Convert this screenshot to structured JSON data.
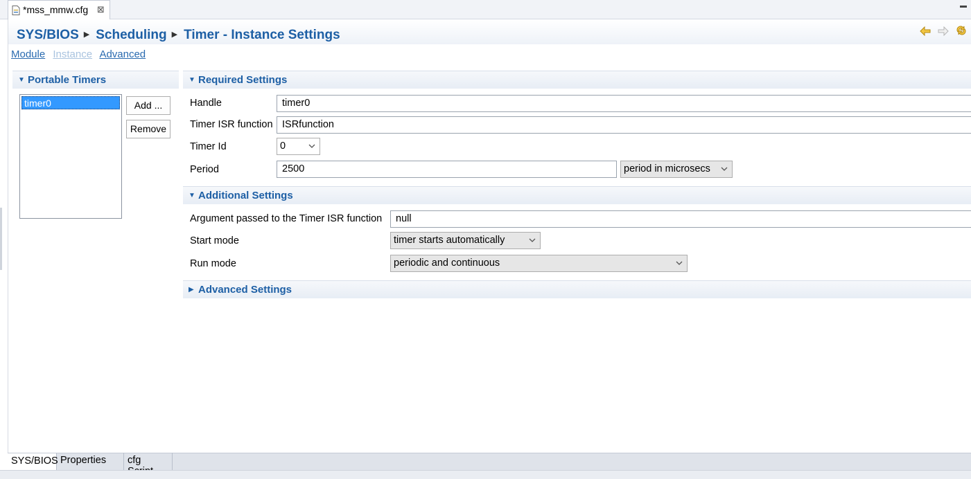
{
  "editor_tab": {
    "title": "*mss_mmw.cfg",
    "close_glyph": "⊠"
  },
  "breadcrumb": [
    "SYS/BIOS",
    "Scheduling",
    "Timer - Instance Settings"
  ],
  "nav_icons": [
    "back-arrow-icon",
    "forward-arrow-icon",
    "sync-icon"
  ],
  "view_links": {
    "module": "Module",
    "instance": "Instance",
    "advanced": "Advanced"
  },
  "portable_timers": {
    "title": "Portable Timers",
    "items": [
      "timer0"
    ],
    "selected": "timer0",
    "add_label": "Add ...",
    "remove_label": "Remove"
  },
  "required_settings": {
    "title": "Required Settings",
    "handle_label": "Handle",
    "handle_value": "timer0",
    "isr_label": "Timer ISR function",
    "isr_value": "ISRfunction",
    "timer_id_label": "Timer Id",
    "timer_id_value": "0",
    "period_label": "Period",
    "period_value": "2500",
    "period_unit": "period in microsecs"
  },
  "additional_settings": {
    "title": "Additional Settings",
    "arg_label": "Argument passed to the Timer ISR function",
    "arg_value": "null",
    "start_mode_label": "Start mode",
    "start_mode_value": "timer starts automatically",
    "run_mode_label": "Run mode",
    "run_mode_value": "periodic and continuous"
  },
  "advanced_settings": {
    "title": "Advanced Settings"
  },
  "bottom_tabs": [
    "SYS/BIOS",
    "Properties",
    "cfg Script"
  ],
  "colors": {
    "accent": "#1d5fa5",
    "selection": "#3399ff",
    "link": "#2a6bb0",
    "link_disabled": "#a9c3df"
  }
}
